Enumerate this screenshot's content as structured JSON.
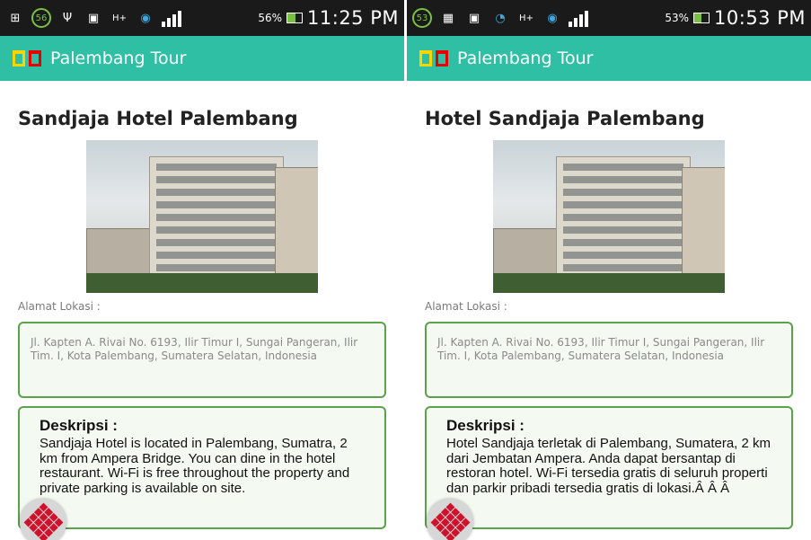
{
  "phones": [
    {
      "status": {
        "notif_count": "56",
        "battery_pct": "56%",
        "battery_fill": 0.56,
        "time": "11:25 PM"
      },
      "app_title": "Palembang Tour",
      "hotel_title": "Sandjaja Hotel Palembang",
      "address_label": "Alamat Lokasi :",
      "address": "Jl. Kapten A. Rivai No. 6193, Ilir Timur I, Sungai Pangeran, Ilir Tim. I, Kota Palembang, Sumatera Selatan, Indonesia",
      "desc_title": "Deskripsi :",
      "desc_text": "Sandjaja Hotel is located in Palembang, Sumatra, 2 km from Ampera Bridge. You can dine in the hotel restaurant. Wi-Fi is free throughout the property and private parking is available on site."
    },
    {
      "status": {
        "notif_count": "53",
        "battery_pct": "53%",
        "battery_fill": 0.53,
        "time": "10:53 PM"
      },
      "app_title": "Palembang Tour",
      "hotel_title": "Hotel Sandjaja Palembang",
      "address_label": "Alamat Lokasi :",
      "address": "Jl. Kapten A. Rivai No. 6193, Ilir Timur I, Sungai Pangeran, Ilir Tim. I, Kota Palembang, Sumatera Selatan, Indonesia",
      "desc_title": "Deskripsi :",
      "desc_text": "Hotel Sandjaja terletak di Palembang, Sumatera, 2 km dari Jembatan Ampera. Anda dapat bersantap di restoran hotel. Wi-Fi tersedia gratis di seluruh properti dan parkir pribadi tersedia gratis di lokasi.Â  Â  Â"
    }
  ],
  "icons": {
    "status_left": [
      "back-icon",
      "usb-icon",
      "chat-icon",
      "hplus-data-icon",
      "sync-icon",
      "signal-icon"
    ],
    "status_right_alt": [
      "image-icon",
      "chat-icon",
      "wifi-icon",
      "hplus-data-icon",
      "sync-icon",
      "signal-icon"
    ],
    "app_logo": "hotel-chairs-logo",
    "fab": "grid-menu-icon"
  },
  "colors": {
    "status_bar": "#1a1a1a",
    "app_bar": "#2fbfa4",
    "box_border": "#5aa34a",
    "fab_accent": "#d0112b"
  }
}
